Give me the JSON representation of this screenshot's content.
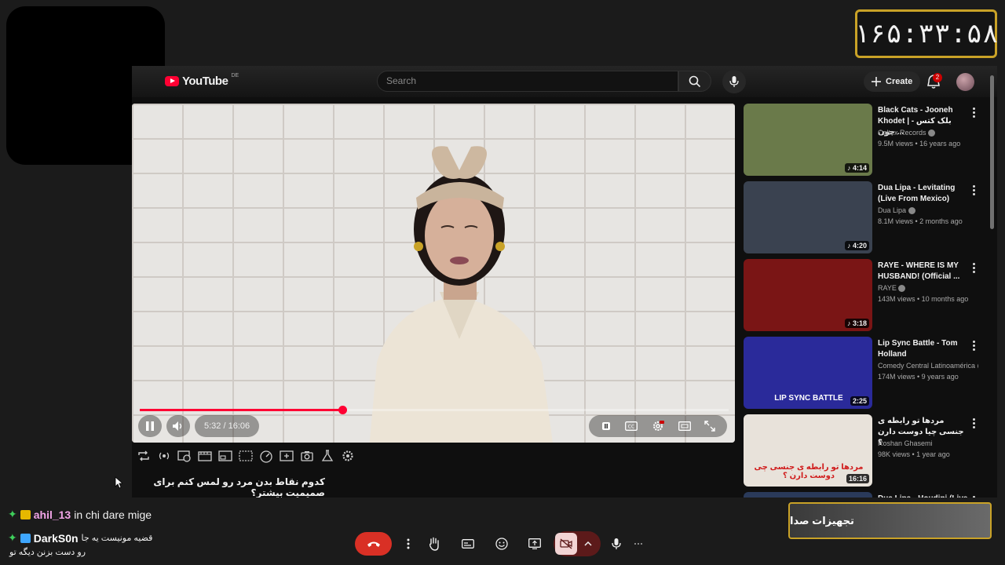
{
  "timer": {
    "value": "۱۶۵:۳۳:۵۸"
  },
  "youtube": {
    "logo_text": "YouTube",
    "logo_region": "DE",
    "search_placeholder": "Search",
    "create_label": "Create",
    "notifications_count": "2",
    "brand_color": "#ff0033"
  },
  "player": {
    "time_display": "5:32 / 16:06",
    "progress_fraction": 0.344,
    "title": "کدوم نقاط بدن مرد رو لمس کنم برای صمیمیت بیشتر؟"
  },
  "recommendations": [
    {
      "title": "Black Cats - Jooneh Khodet | بلک کتس - جون ...",
      "channel": "Caltex Records",
      "verified": true,
      "meta": "9.5M views • 16 years ago",
      "duration": "4:14",
      "music": true,
      "thumb_color": "#6a7a4a"
    },
    {
      "title": "Dua Lipa - Levitating (Live From Mexico)",
      "channel": "Dua Lipa",
      "verified": true,
      "meta": "8.1M views • 2 months ago",
      "duration": "4:20",
      "music": true,
      "thumb_color": "#3a4250"
    },
    {
      "title": "RAYE - WHERE IS MY HUSBAND! (Official ...",
      "channel": "RAYE",
      "verified": true,
      "meta": "143M views • 10 months ago",
      "duration": "3:18",
      "music": true,
      "thumb_color": "#7a1515"
    },
    {
      "title": "Lip Sync Battle - Tom Holland",
      "channel": "Comedy Central Latinoamérica",
      "verified": true,
      "meta": "174M views • 9 years ago",
      "duration": "2:25",
      "music": false,
      "thumb_color": "#2a2a9a",
      "thumb_caption": "LIP SYNC BATTLE"
    },
    {
      "title": "مردها تو رابطه ی جنسی چیا دوست دارن ؟",
      "channel": "Roshan Ghasemi",
      "verified": false,
      "meta": "98K views • 1 year ago",
      "duration": "16:16",
      "music": false,
      "thumb_color": "#e8e2da",
      "thumb_caption": "مردها تو رابطه ی جنسی چی دوست دارن ؟"
    },
    {
      "title": "Dua Lipa - Houdini (Live ...",
      "channel": "",
      "verified": false,
      "meta": "",
      "duration": "",
      "music": false,
      "thumb_color": "#2a3a5a"
    }
  ],
  "chat": {
    "line1_user": "ahil_13",
    "line1_text": "in chi dare mige",
    "line2_user": "DarkS0n",
    "line2_text_a": "قضیه مونیست یه جا",
    "line2_text_b": "رو دست بزنن دیگه تو"
  },
  "audio_panel": {
    "label": "تجهیزات صدا"
  },
  "icons": {
    "hangup": "phone-hangup-icon",
    "camera_off": "camera-off-icon",
    "mic": "mic-icon"
  }
}
